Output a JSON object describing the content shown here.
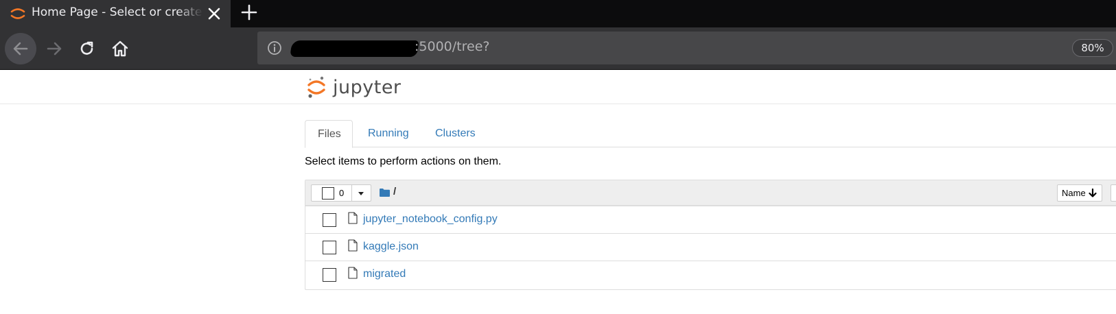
{
  "browser": {
    "tab_title": "Home Page - Select or create a notebook",
    "url_visible": ":5000/tree?",
    "zoom": "80%"
  },
  "jupyter": {
    "logo_text": "jupyter",
    "tabs": [
      {
        "label": "Files",
        "active": true
      },
      {
        "label": "Running",
        "active": false
      },
      {
        "label": "Clusters",
        "active": false
      }
    ],
    "hint": "Select items to perform actions on them.",
    "selected_count": "0",
    "path_separator": "/",
    "sort_label": "Name",
    "files": [
      {
        "name": "jupyter_notebook_config.py"
      },
      {
        "name": "kaggle.json"
      },
      {
        "name": "migrated"
      }
    ]
  },
  "colors": {
    "link": "#337ab7",
    "chrome_dark": "#0c0c0d",
    "chrome_toolbar": "#323234",
    "jupyter_orange": "#f37726"
  }
}
